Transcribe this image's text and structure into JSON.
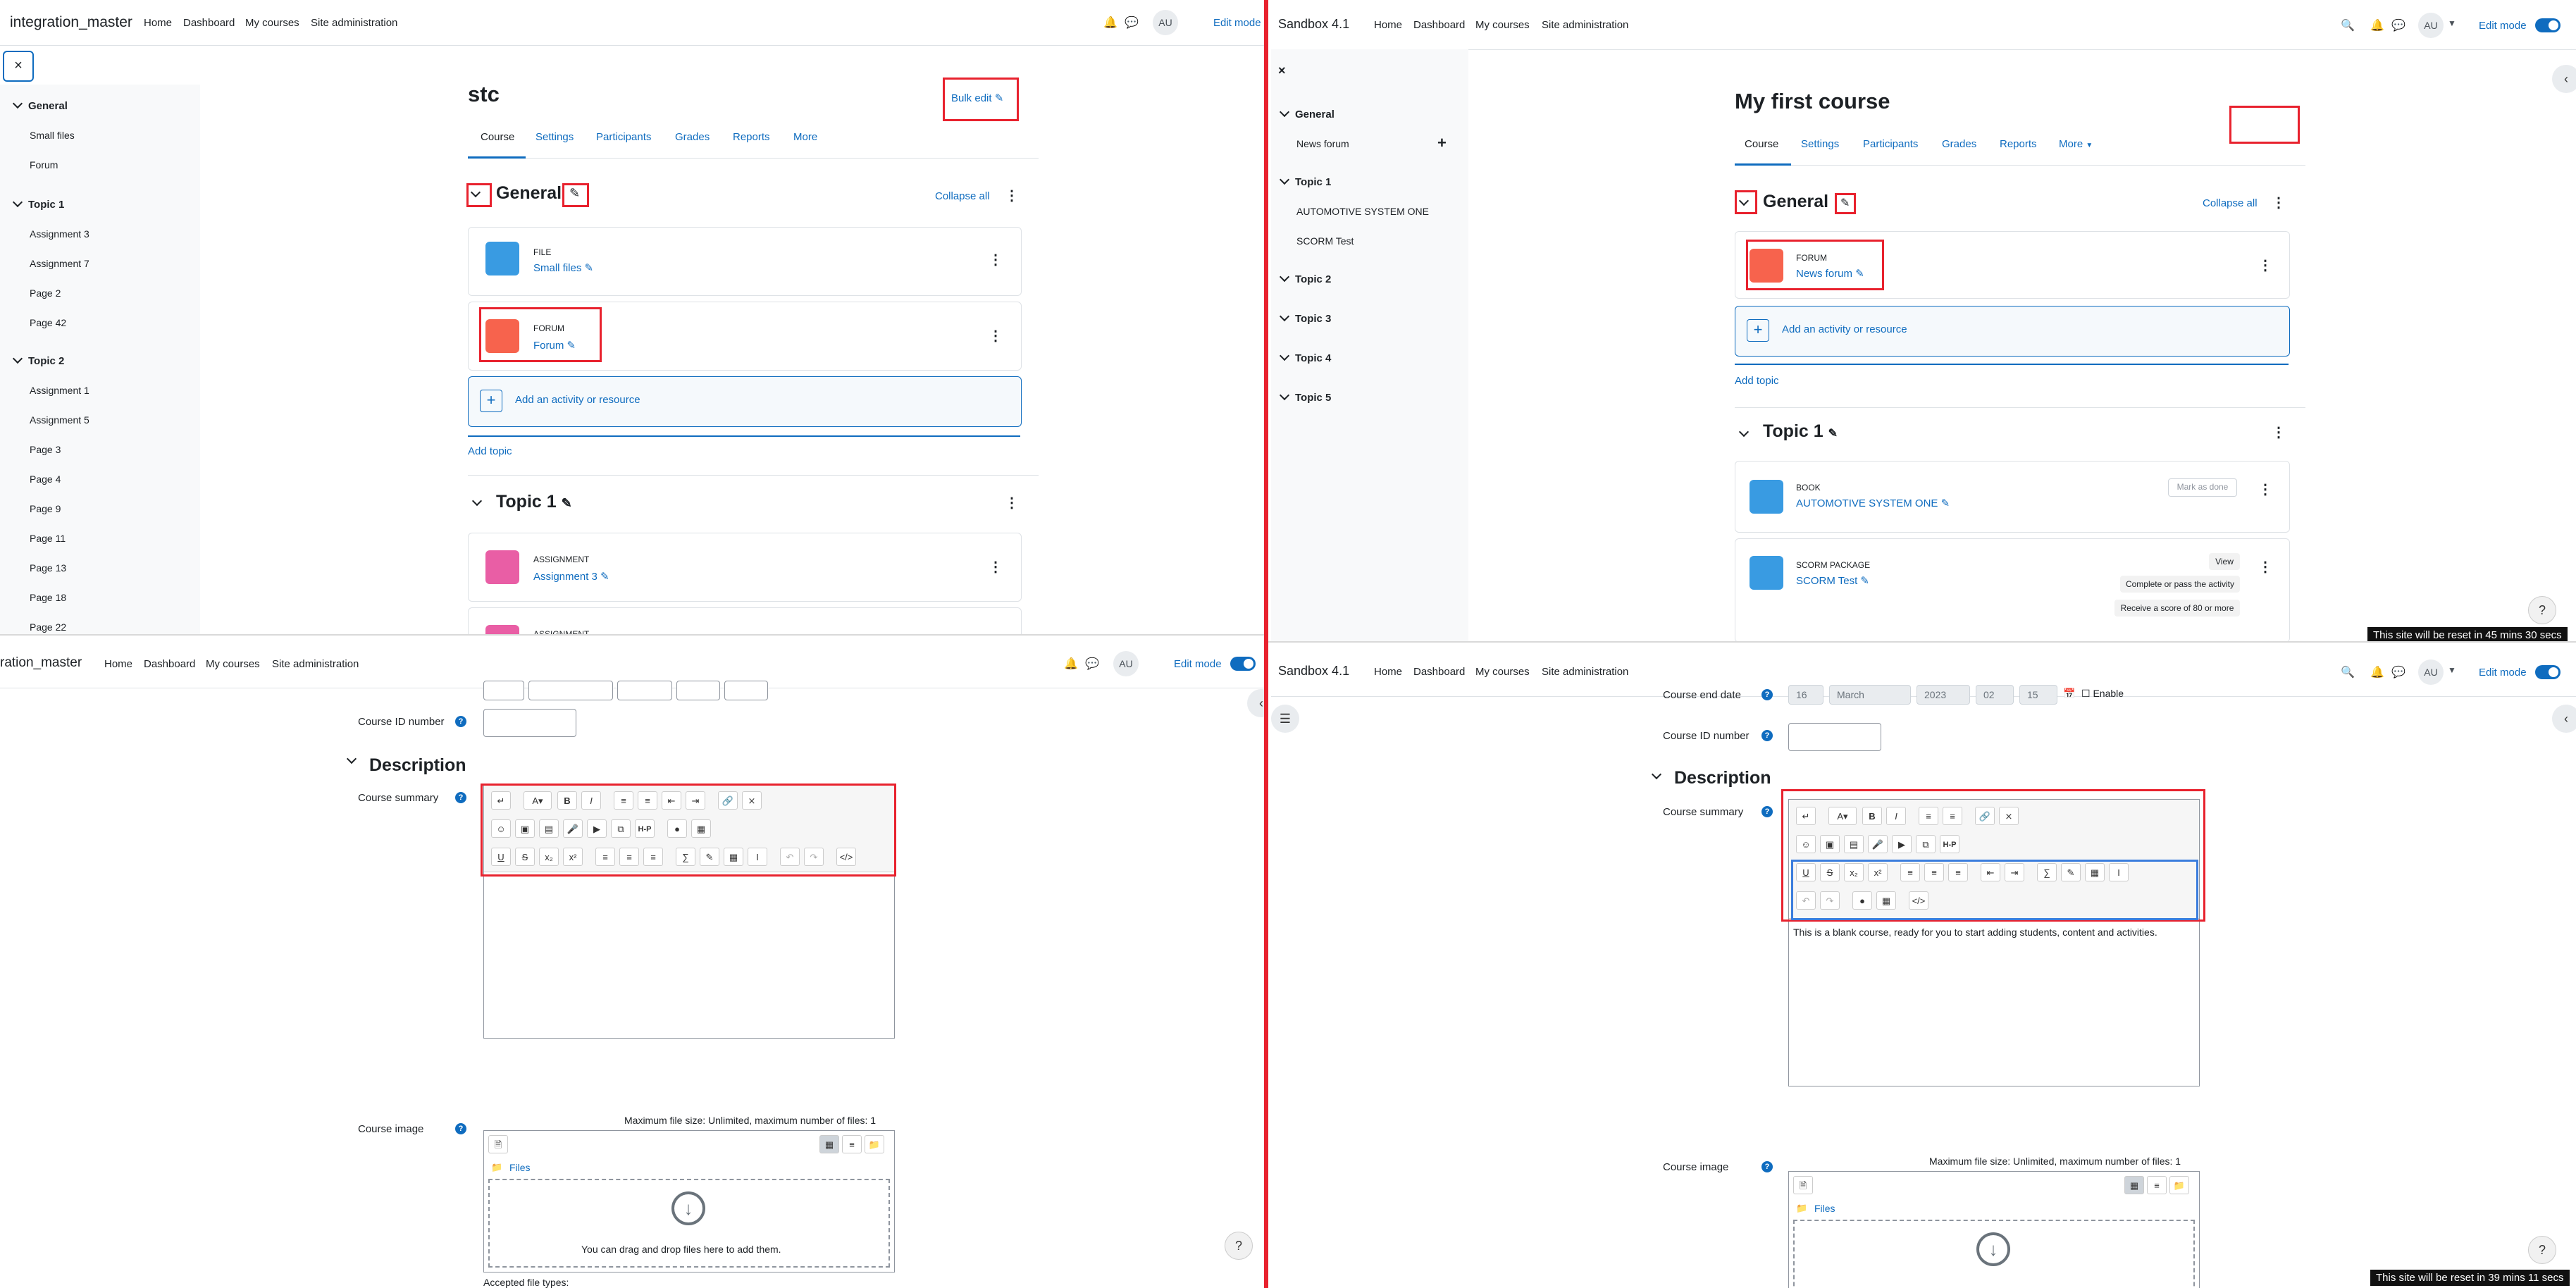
{
  "q1": {
    "brand": "integration_master",
    "nav": [
      "Home",
      "Dashboard",
      "My courses",
      "Site administration"
    ],
    "avatar": "AU",
    "edit_mode": "Edit mode",
    "close": "×",
    "sidebar": [
      {
        "h": "General",
        "items": [
          "Small files",
          "Forum"
        ]
      },
      {
        "h": "Topic 1",
        "items": [
          "Assignment 3",
          "Assignment 7",
          "Page 2",
          "Page 42"
        ]
      },
      {
        "h": "Topic 2",
        "items": [
          "Assignment 1",
          "Assignment 5",
          "Page 3",
          "Page 4",
          "Page 9",
          "Page 11",
          "Page 13",
          "Page 18",
          "Page 22"
        ]
      }
    ],
    "title": "stc",
    "bulk_edit": "Bulk edit",
    "tabs": [
      "Course",
      "Settings",
      "Participants",
      "Grades",
      "Reports",
      "More"
    ],
    "section_general": "General",
    "collapse_all": "Collapse all",
    "activities": [
      {
        "type": "File",
        "name": "Small files"
      },
      {
        "type": "Forum",
        "name": "Forum"
      }
    ],
    "add_activity": "Add an activity or resource",
    "add_topic": "Add topic",
    "section_topic1": "Topic 1",
    "assign1": {
      "type": "Assignment",
      "name": "Assignment 3"
    },
    "assign2": {
      "type": "Assignment"
    }
  },
  "q2": {
    "brand": "Sandbox 4.1",
    "nav": [
      "Home",
      "Dashboard",
      "My courses",
      "Site administration"
    ],
    "avatar": "AU",
    "edit_mode": "Edit mode",
    "close": "×",
    "sidebar": [
      {
        "h": "General",
        "items": [
          "News forum"
        ]
      },
      {
        "h": "Topic 1",
        "items": [
          "AUTOMOTIVE SYSTEM ONE",
          "SCORM Test"
        ]
      },
      {
        "h": "Topic 2",
        "items": []
      },
      {
        "h": "Topic 3",
        "items": []
      },
      {
        "h": "Topic 4",
        "items": []
      },
      {
        "h": "Topic 5",
        "items": []
      }
    ],
    "title": "My first course",
    "tabs": [
      "Course",
      "Settings",
      "Participants",
      "Grades",
      "Reports",
      "More"
    ],
    "section_general": "General",
    "collapse_all": "Collapse all",
    "forum": {
      "type": "Forum",
      "name": "News forum"
    },
    "add_activity": "Add an activity or resource",
    "add_topic": "Add topic",
    "section_topic1": "Topic 1",
    "book": {
      "type": "Book",
      "name": "AUTOMOTIVE SYSTEM ONE",
      "mark": "Mark as done"
    },
    "scorm": {
      "type": "SCORM package",
      "name": "SCORM Test",
      "view": "View",
      "c1": "Complete or pass the activity",
      "c2": "Receive a score of 80 or more"
    },
    "help": "?",
    "toast": "This site will be reset in 45 mins 30 secs"
  },
  "q3": {
    "brand": "ration_master",
    "nav": [
      "Home",
      "Dashboard",
      "My courses",
      "Site administration"
    ],
    "avatar": "AU",
    "edit_mode": "Edit mode",
    "course_id_label": "Course ID number",
    "description": "Description",
    "course_summary": "Course summary",
    "max_file": "Maximum file size: Unlimited, maximum number of files: 1",
    "course_image": "Course image",
    "files": "Files",
    "drag_drop": "You can drag and drop files here to add them.",
    "accepted": "Accepted file types:",
    "help": "?"
  },
  "q4": {
    "brand": "Sandbox 4.1",
    "nav": [
      "Home",
      "Dashboard",
      "My courses",
      "Site administration"
    ],
    "avatar": "AU",
    "edit_mode": "Edit mode",
    "end_date_label": "Course end date",
    "end_date": {
      "day": "16",
      "month": "March",
      "year": "2023",
      "hour": "02",
      "minute": "15",
      "enable": "Enable"
    },
    "course_id_label": "Course ID number",
    "description": "Description",
    "course_summary": "Course summary",
    "summary_text": "This is a blank course, ready for you to start adding students, content and activities.",
    "max_file": "Maximum file size: Unlimited, maximum number of files: 1",
    "course_image": "Course image",
    "files": "Files",
    "help": "?",
    "toast": "This site will be reset in 39 mins 11 secs"
  }
}
